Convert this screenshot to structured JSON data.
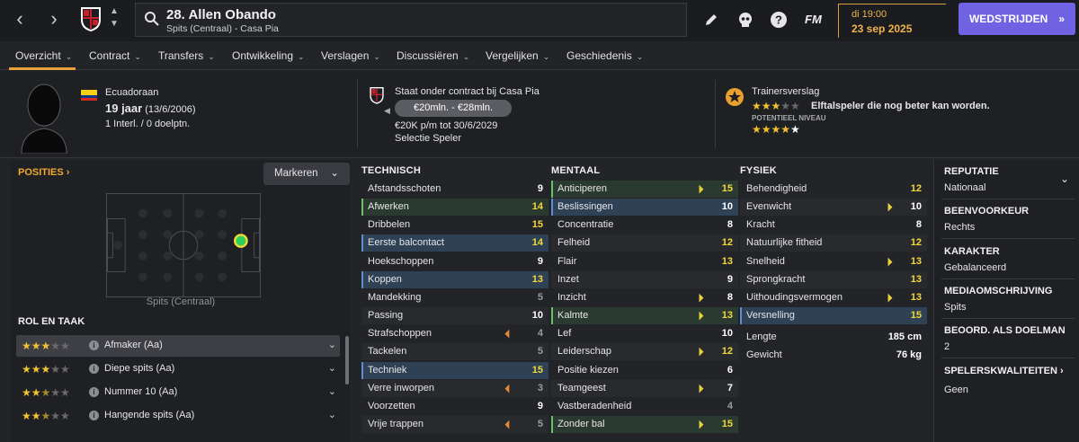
{
  "topbar": {
    "back_icon": "chevron-left-icon",
    "forward_icon": "chevron-right-icon",
    "player_title": "28. Allen Obando",
    "player_subtitle": "Spits (Centraal) - Casa Pia",
    "fm_label": "FM",
    "date_time": "di 19:00",
    "date_day": "23 sep 2025",
    "continue_label": "WEDSTRIJDEN",
    "accent_color": "#6f62e3"
  },
  "tabs": [
    {
      "label": "Overzicht"
    },
    {
      "label": "Contract"
    },
    {
      "label": "Transfers"
    },
    {
      "label": "Ontwikkeling"
    },
    {
      "label": "Verslagen"
    },
    {
      "label": "Discussiëren"
    },
    {
      "label": "Vergelijken"
    },
    {
      "label": "Geschiedenis"
    }
  ],
  "header": {
    "nationality": "Ecuadoraan",
    "age_main": "19 jaar",
    "age_detail": "(13/6/2006)",
    "caps": "1 Interl. / 0 doelptn.",
    "contract_line": "Staat onder contract bij Casa Pia",
    "value_range": "€20mln. - €28mln.",
    "wage": "€20K p/m tot 30/6/2029",
    "squad_status": "Selectie Speler",
    "report_title": "Trainersverslag",
    "report_text": "Elftalspeler die nog beter kan worden.",
    "potential_label": "POTENTIEEL NIVEAU",
    "current_stars": 3,
    "potential_stars": 5
  },
  "positions": {
    "title": "POSITIES",
    "highlight_button": "Markeren",
    "pitch_label": "Spits (Centraal)",
    "role_title": "ROL EN TAAK",
    "roles": [
      {
        "name": "Afmaker (Aa)",
        "stars": 3
      },
      {
        "name": "Diepe spits (Aa)",
        "stars": 3
      },
      {
        "name": "Nummer 10 (Aa)",
        "stars": 2.5
      },
      {
        "name": "Hangende spits (Aa)",
        "stars": 2.5
      }
    ]
  },
  "technical": {
    "title": "TECHNISCH",
    "rows": [
      {
        "label": "Afstandsschoten",
        "value": "9",
        "hl": "",
        "arrow": ""
      },
      {
        "label": "Afwerken",
        "value": "14",
        "hl": "g",
        "arrow": ""
      },
      {
        "label": "Dribbelen",
        "value": "15",
        "hl": "",
        "arrow": ""
      },
      {
        "label": "Eerste balcontact",
        "value": "14",
        "hl": "b",
        "arrow": ""
      },
      {
        "label": "Hoekschoppen",
        "value": "9",
        "hl": "",
        "arrow": ""
      },
      {
        "label": "Koppen",
        "value": "13",
        "hl": "b",
        "arrow": ""
      },
      {
        "label": "Mandekking",
        "value": "5",
        "hl": "",
        "arrow": ""
      },
      {
        "label": "Passing",
        "value": "10",
        "hl": "",
        "arrow": ""
      },
      {
        "label": "Strafschoppen",
        "value": "4",
        "hl": "",
        "arrow": "down"
      },
      {
        "label": "Tackelen",
        "value": "5",
        "hl": "",
        "arrow": ""
      },
      {
        "label": "Techniek",
        "value": "15",
        "hl": "b",
        "arrow": ""
      },
      {
        "label": "Verre inworpen",
        "value": "3",
        "hl": "",
        "arrow": "down"
      },
      {
        "label": "Voorzetten",
        "value": "9",
        "hl": "",
        "arrow": ""
      },
      {
        "label": "Vrije trappen",
        "value": "5",
        "hl": "",
        "arrow": "down"
      }
    ]
  },
  "mental": {
    "title": "MENTAAL",
    "rows": [
      {
        "label": "Anticiperen",
        "value": "15",
        "hl": "g",
        "arrow": "up"
      },
      {
        "label": "Beslissingen",
        "value": "10",
        "hl": "b",
        "arrow": ""
      },
      {
        "label": "Concentratie",
        "value": "8",
        "hl": "",
        "arrow": ""
      },
      {
        "label": "Felheid",
        "value": "12",
        "hl": "",
        "arrow": ""
      },
      {
        "label": "Flair",
        "value": "13",
        "hl": "",
        "arrow": ""
      },
      {
        "label": "Inzet",
        "value": "9",
        "hl": "",
        "arrow": ""
      },
      {
        "label": "Inzicht",
        "value": "8",
        "hl": "",
        "arrow": "up"
      },
      {
        "label": "Kalmte",
        "value": "13",
        "hl": "g",
        "arrow": "up"
      },
      {
        "label": "Lef",
        "value": "10",
        "hl": "",
        "arrow": ""
      },
      {
        "label": "Leiderschap",
        "value": "12",
        "hl": "",
        "arrow": "up"
      },
      {
        "label": "Positie kiezen",
        "value": "6",
        "hl": "",
        "arrow": ""
      },
      {
        "label": "Teamgeest",
        "value": "7",
        "hl": "",
        "arrow": "up"
      },
      {
        "label": "Vastberadenheid",
        "value": "4",
        "hl": "",
        "arrow": ""
      },
      {
        "label": "Zonder bal",
        "value": "15",
        "hl": "g",
        "arrow": "up"
      }
    ]
  },
  "physical": {
    "title": "FYSIEK",
    "rows": [
      {
        "label": "Behendigheid",
        "value": "12",
        "hl": "",
        "arrow": ""
      },
      {
        "label": "Evenwicht",
        "value": "10",
        "hl": "",
        "arrow": "up"
      },
      {
        "label": "Kracht",
        "value": "8",
        "hl": "",
        "arrow": ""
      },
      {
        "label": "Natuurlijke fitheid",
        "value": "12",
        "hl": "",
        "arrow": ""
      },
      {
        "label": "Snelheid",
        "value": "13",
        "hl": "",
        "arrow": "up"
      },
      {
        "label": "Sprongkracht",
        "value": "13",
        "hl": "",
        "arrow": ""
      },
      {
        "label": "Uithoudingsvermogen",
        "value": "13",
        "hl": "",
        "arrow": "up"
      },
      {
        "label": "Versnelling",
        "value": "15",
        "hl": "b",
        "arrow": ""
      }
    ],
    "length_label": "Lengte",
    "length_value": "185 cm",
    "weight_label": "Gewicht",
    "weight_value": "76 kg"
  },
  "info": {
    "reputation_h": "REPUTATIE",
    "reputation_v": "Nationaal",
    "foot_h": "BEENVOORKEUR",
    "foot_v": "Rechts",
    "character_h": "KARAKTER",
    "character_v": "Gebalanceerd",
    "media_h": "MEDIAOMSCHRIJVING",
    "media_v": "Spits",
    "gk_h": "BEOORD. ALS DOELMAN",
    "gk_v": "2",
    "traits_h": "SPELERSKWALITEITEN",
    "traits_v": "Geen"
  },
  "colors": {
    "value_yellow": "#f2d93a",
    "value_white": "#ffffff",
    "value_grey": "#9a9ba0",
    "highlight_blue": "#2e4155",
    "highlight_green": "#2b3a30",
    "orange": "#f0a830"
  }
}
